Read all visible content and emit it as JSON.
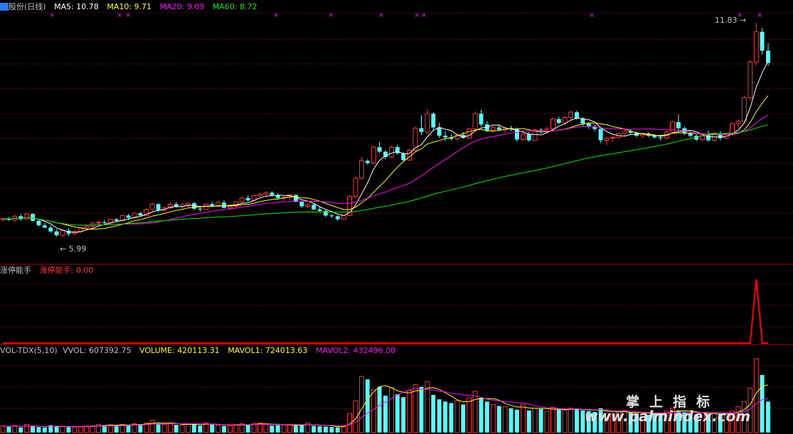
{
  "header": {
    "stock_name": "股份(日线)",
    "ma5_label": "MA5: 10.78",
    "ma10_label": "MA10: 9.71",
    "ma20_label": "MA20: 9.09",
    "ma60_label": "MA60: 8.72"
  },
  "indicator": {
    "name": "涨停能手",
    "value_label": "涨停能手: 0.00"
  },
  "volume_header": {
    "name": "VOL-TDX(5,10)",
    "vvol": "VVOL: 607392.75",
    "volume": "VOLUME: 420113.31",
    "mavol1": "MAVOL1: 724013.63",
    "mavol2": "MAVOL2: 432496.00"
  },
  "price_labels": {
    "high": "11.83",
    "low": "5.99"
  },
  "watermark": {
    "cn": "掌上指标",
    "url": "www.palmindex.com"
  },
  "colors": {
    "up": "#ff3232",
    "down": "#54ffff",
    "ma5": "#ffffff",
    "ma10": "#ffff00",
    "ma20": "#ff00ff",
    "ma60": "#00e600",
    "grid": "#8b0000",
    "indicator_line": "#ff0000"
  },
  "chart_data": {
    "type": "candlestick",
    "candles": [
      [
        6.65,
        6.7,
        6.6,
        6.68
      ],
      [
        6.68,
        6.72,
        6.62,
        6.64
      ],
      [
        6.64,
        6.78,
        6.6,
        6.74
      ],
      [
        6.74,
        6.8,
        6.62,
        6.66
      ],
      [
        6.66,
        6.84,
        6.64,
        6.8
      ],
      [
        6.8,
        6.82,
        6.6,
        6.62
      ],
      [
        6.62,
        6.66,
        6.48,
        6.5
      ],
      [
        6.5,
        6.56,
        6.42,
        6.44
      ],
      [
        6.44,
        6.5,
        6.3,
        6.34
      ],
      [
        6.34,
        6.4,
        6.2,
        6.24
      ],
      [
        6.24,
        6.4,
        6.2,
        6.36
      ],
      [
        6.36,
        6.42,
        6.22,
        6.28
      ],
      [
        6.28,
        6.38,
        6.24,
        6.34
      ],
      [
        6.34,
        6.46,
        6.3,
        6.44
      ],
      [
        6.44,
        6.52,
        6.38,
        6.48
      ],
      [
        6.48,
        6.6,
        6.44,
        6.56
      ],
      [
        6.56,
        6.62,
        6.5,
        6.58
      ],
      [
        6.58,
        6.64,
        6.54,
        6.56
      ],
      [
        6.56,
        6.68,
        6.52,
        6.66
      ],
      [
        6.66,
        6.7,
        6.58,
        6.62
      ],
      [
        6.62,
        6.78,
        6.6,
        6.76
      ],
      [
        6.76,
        6.8,
        6.66,
        6.7
      ],
      [
        6.7,
        6.84,
        6.66,
        6.82
      ],
      [
        6.82,
        6.86,
        6.72,
        6.76
      ],
      [
        6.76,
        6.94,
        6.74,
        6.92
      ],
      [
        6.92,
        7.1,
        6.88,
        7.06
      ],
      [
        7.06,
        7.08,
        6.86,
        6.9
      ],
      [
        6.9,
        7.0,
        6.86,
        6.96
      ],
      [
        6.96,
        7.1,
        6.92,
        7.06
      ],
      [
        7.06,
        7.12,
        6.96,
        7.0
      ],
      [
        7.0,
        7.08,
        6.94,
        7.04
      ],
      [
        7.04,
        7.1,
        6.98,
        7.08
      ],
      [
        7.08,
        7.12,
        6.9,
        6.94
      ],
      [
        6.94,
        7.0,
        6.86,
        6.92
      ],
      [
        6.92,
        7.08,
        6.9,
        7.06
      ],
      [
        7.06,
        7.12,
        6.98,
        7.02
      ],
      [
        7.02,
        7.14,
        6.98,
        7.1
      ],
      [
        7.1,
        7.16,
        6.94,
        6.96
      ],
      [
        6.96,
        7.02,
        6.9,
        7.0
      ],
      [
        7.0,
        7.14,
        6.96,
        7.12
      ],
      [
        7.12,
        7.26,
        7.08,
        7.22
      ],
      [
        7.22,
        7.28,
        7.12,
        7.16
      ],
      [
        7.16,
        7.3,
        7.12,
        7.28
      ],
      [
        7.28,
        7.36,
        7.2,
        7.32
      ],
      [
        7.32,
        7.4,
        7.24,
        7.36
      ],
      [
        7.36,
        7.4,
        7.26,
        7.3
      ],
      [
        7.3,
        7.34,
        7.18,
        7.22
      ],
      [
        7.22,
        7.28,
        7.14,
        7.24
      ],
      [
        7.24,
        7.34,
        7.16,
        7.3
      ],
      [
        7.3,
        7.32,
        7.1,
        7.12
      ],
      [
        7.12,
        7.14,
        6.96,
        7.0
      ],
      [
        7.0,
        7.08,
        6.94,
        7.04
      ],
      [
        7.04,
        7.06,
        6.9,
        6.92
      ],
      [
        6.92,
        6.98,
        6.84,
        6.88
      ],
      [
        6.88,
        6.92,
        6.72,
        6.76
      ],
      [
        6.76,
        6.8,
        6.7,
        6.74
      ],
      [
        6.74,
        6.76,
        6.62,
        6.66
      ],
      [
        6.66,
        6.78,
        6.64,
        6.76
      ],
      [
        6.76,
        7.3,
        6.74,
        7.26
      ],
      [
        7.26,
        7.8,
        7.2,
        7.74
      ],
      [
        7.74,
        8.3,
        7.7,
        8.2
      ],
      [
        8.2,
        8.24,
        8.1,
        8.14
      ],
      [
        8.14,
        8.6,
        8.1,
        8.56
      ],
      [
        8.56,
        8.7,
        8.4,
        8.44
      ],
      [
        8.44,
        8.48,
        8.24,
        8.3
      ],
      [
        8.3,
        8.6,
        8.26,
        8.56
      ],
      [
        8.56,
        8.62,
        8.36,
        8.4
      ],
      [
        8.4,
        8.44,
        8.18,
        8.22
      ],
      [
        8.22,
        8.52,
        8.2,
        8.48
      ],
      [
        8.48,
        9.1,
        8.44,
        9.06
      ],
      [
        9.06,
        9.4,
        8.88,
        8.96
      ],
      [
        8.96,
        9.56,
        8.9,
        9.44
      ],
      [
        9.44,
        9.48,
        9.02,
        9.08
      ],
      [
        9.08,
        9.2,
        8.8,
        8.86
      ],
      [
        8.86,
        8.98,
        8.72,
        8.82
      ],
      [
        8.82,
        8.9,
        8.74,
        8.78
      ],
      [
        8.78,
        8.92,
        8.72,
        8.88
      ],
      [
        8.88,
        8.96,
        8.78,
        8.8
      ],
      [
        8.8,
        9.08,
        8.78,
        9.04
      ],
      [
        9.04,
        9.5,
        9.0,
        9.44
      ],
      [
        9.44,
        9.54,
        9.1,
        9.16
      ],
      [
        9.16,
        9.24,
        8.96,
        9.0
      ],
      [
        9.0,
        9.12,
        8.94,
        9.08
      ],
      [
        9.08,
        9.16,
        8.98,
        9.02
      ],
      [
        9.02,
        9.1,
        8.94,
        9.06
      ],
      [
        9.06,
        9.12,
        8.98,
        9.04
      ],
      [
        9.04,
        9.08,
        8.7,
        8.76
      ],
      [
        8.76,
        8.94,
        8.72,
        8.9
      ],
      [
        8.9,
        8.96,
        8.7,
        8.74
      ],
      [
        8.74,
        9.04,
        8.72,
        9.02
      ],
      [
        9.02,
        9.06,
        8.92,
        9.0
      ],
      [
        9.0,
        9.1,
        8.94,
        9.04
      ],
      [
        9.04,
        9.34,
        9.0,
        9.3
      ],
      [
        9.3,
        9.36,
        9.16,
        9.2
      ],
      [
        9.2,
        9.38,
        9.16,
        9.34
      ],
      [
        9.34,
        9.52,
        9.3,
        9.48
      ],
      [
        9.48,
        9.52,
        9.28,
        9.32
      ],
      [
        9.32,
        9.36,
        9.12,
        9.18
      ],
      [
        9.18,
        9.22,
        9.04,
        9.1
      ],
      [
        9.1,
        9.14,
        8.98,
        9.04
      ],
      [
        9.04,
        9.06,
        8.68,
        8.74
      ],
      [
        8.74,
        8.84,
        8.62,
        8.8
      ],
      [
        8.8,
        8.86,
        8.7,
        8.82
      ],
      [
        8.82,
        8.96,
        8.78,
        8.92
      ],
      [
        8.92,
        9.02,
        8.86,
        8.98
      ],
      [
        8.98,
        9.04,
        8.88,
        8.94
      ],
      [
        8.94,
        8.98,
        8.82,
        8.86
      ],
      [
        8.86,
        8.94,
        8.8,
        8.9
      ],
      [
        8.9,
        8.96,
        8.82,
        8.86
      ],
      [
        8.86,
        8.9,
        8.78,
        8.82
      ],
      [
        8.82,
        8.86,
        8.74,
        8.8
      ],
      [
        8.8,
        9.0,
        8.76,
        8.96
      ],
      [
        8.96,
        9.26,
        8.92,
        9.22
      ],
      [
        9.22,
        9.42,
        9.0,
        9.06
      ],
      [
        9.06,
        9.1,
        8.88,
        8.92
      ],
      [
        8.92,
        8.98,
        8.82,
        8.86
      ],
      [
        8.86,
        8.9,
        8.72,
        8.76
      ],
      [
        8.76,
        8.92,
        8.72,
        8.88
      ],
      [
        8.88,
        9.0,
        8.7,
        8.74
      ],
      [
        8.74,
        8.96,
        8.7,
        8.92
      ],
      [
        8.92,
        8.98,
        8.74,
        8.8
      ],
      [
        8.8,
        8.94,
        8.76,
        8.9
      ],
      [
        8.9,
        9.22,
        8.86,
        9.18
      ],
      [
        9.18,
        9.3,
        9.06,
        9.24
      ],
      [
        9.24,
        9.92,
        9.2,
        9.86
      ],
      [
        9.86,
        10.86,
        9.8,
        10.8
      ],
      [
        10.8,
        11.83,
        10.7,
        11.6
      ],
      [
        11.6,
        11.7,
        11.0,
        11.1
      ],
      [
        11.1,
        11.3,
        10.7,
        10.78
      ]
    ],
    "ma_values": {
      "MA5": 10.78,
      "MA10": 9.71,
      "MA20": 9.09,
      "MA60": 8.72
    },
    "high": 11.83,
    "low": 5.99,
    "limit_up_signal": [
      0,
      0,
      0,
      0,
      0,
      0,
      0,
      0,
      0,
      0,
      0,
      0,
      0,
      0,
      0,
      0,
      0,
      0,
      0,
      0,
      0,
      0,
      0,
      0,
      0,
      0,
      0,
      0,
      0,
      0,
      0,
      0,
      0,
      0,
      0,
      0,
      0,
      0,
      0,
      0,
      0,
      0,
      0,
      0,
      0,
      0,
      0,
      0,
      0,
      0,
      0,
      0,
      0,
      0,
      0,
      0,
      0,
      0,
      0,
      0,
      0,
      0,
      0,
      0,
      0,
      0,
      0,
      0,
      0,
      0,
      0,
      0,
      0,
      0,
      0,
      0,
      0,
      0,
      0,
      0,
      0,
      0,
      0,
      0,
      0,
      0,
      0,
      0,
      0,
      0,
      0,
      0,
      0,
      0,
      0,
      0,
      0,
      0,
      0,
      0,
      0,
      0,
      0,
      0,
      0,
      0,
      0,
      0,
      0,
      0,
      0,
      0,
      0,
      0,
      0,
      0,
      0,
      0,
      0,
      0,
      0,
      0,
      0,
      0,
      0,
      0,
      1,
      0,
      0
    ],
    "volumes": [
      90,
      80,
      95,
      70,
      110,
      85,
      75,
      70,
      100,
      90,
      80,
      75,
      70,
      85,
      90,
      95,
      110,
      100,
      105,
      95,
      110,
      100,
      120,
      115,
      130,
      165,
      120,
      110,
      125,
      105,
      100,
      115,
      120,
      95,
      130,
      115,
      100,
      90,
      95,
      110,
      120,
      100,
      125,
      130,
      115,
      95,
      100,
      105,
      110,
      95,
      100,
      130,
      90,
      85,
      80,
      75,
      70,
      85,
      260,
      430,
      760,
      720,
      580,
      620,
      500,
      610,
      520,
      480,
      570,
      650,
      620,
      690,
      510,
      450,
      420,
      400,
      430,
      380,
      470,
      560,
      470,
      420,
      380,
      360,
      350,
      330,
      310,
      380,
      300,
      330,
      320,
      290,
      340,
      310,
      300,
      330,
      320,
      300,
      290,
      280,
      330,
      260,
      250,
      280,
      300,
      270,
      260,
      250,
      240,
      260,
      270,
      290,
      330,
      300,
      280,
      260,
      240,
      270,
      250,
      260,
      250,
      240,
      290,
      350,
      420,
      600,
      1000,
      780,
      420
    ],
    "up_down_markers": "x",
    "mavol_values": {
      "VVOL": 607392.75,
      "VOLUME": 420113.31,
      "MAVOL1": 724013.63,
      "MAVOL2": 432496.0
    }
  }
}
